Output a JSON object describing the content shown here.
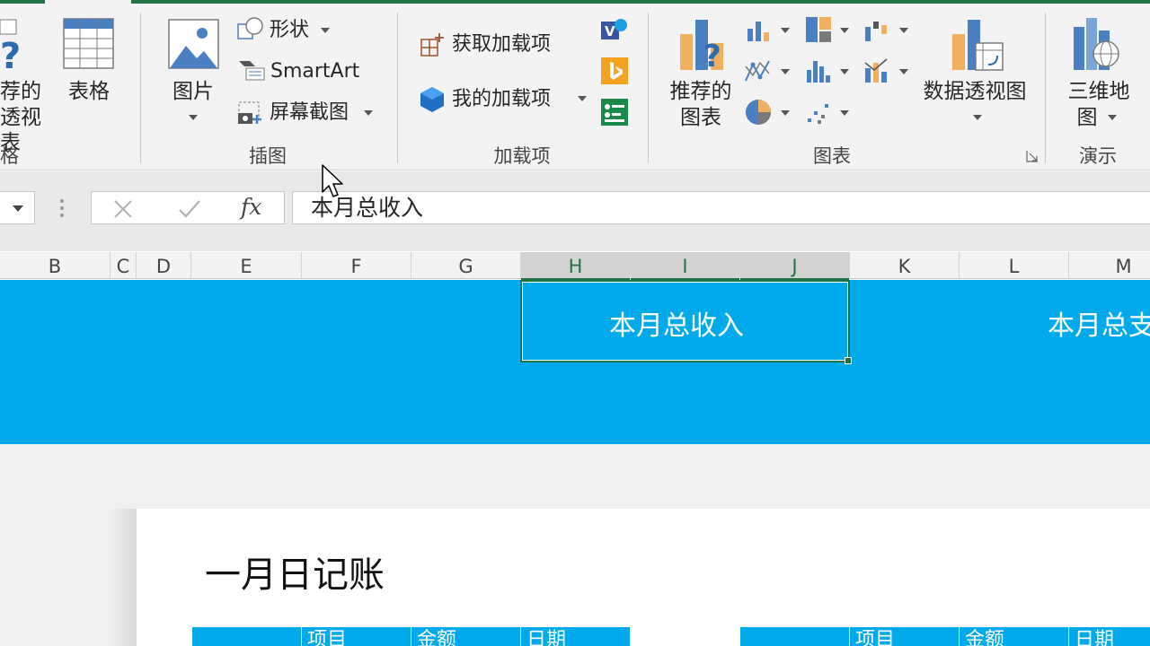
{
  "ribbon": {
    "clipped_left": {
      "label_line1": "荐的",
      "label_line2": "透视表",
      "group": "格"
    },
    "table": {
      "label": "表格"
    },
    "illustrations": {
      "picture": "图片",
      "shapes": "形状",
      "smartart": "SmartArt",
      "screenshot": "屏幕截图",
      "group": "插图"
    },
    "addins": {
      "get": "获取加载项",
      "my": "我的加载项",
      "group": "加载项"
    },
    "charts": {
      "recommended_line1": "推荐的",
      "recommended_line2": "图表",
      "pivot_chart": "数据透视图",
      "group": "图表"
    },
    "tours": {
      "map_line1": "三维地",
      "map_line2": "图",
      "group": "演示"
    }
  },
  "formula_bar": {
    "fx": "fx",
    "content": "本月总收入"
  },
  "columns": [
    "B",
    "C",
    "D",
    "E",
    "F",
    "G",
    "H",
    "I",
    "J",
    "K",
    "L",
    "M"
  ],
  "sheet": {
    "banner_cell_1": "本月总收入",
    "banner_cell_2": "本月总支",
    "card_title": "一月日记账",
    "table1_headers": [
      "项目",
      "金额",
      "日期"
    ],
    "table2_headers": [
      "项目",
      "金额",
      "日期"
    ]
  },
  "colors": {
    "banner": "#00aaea",
    "accent_green": "#217346",
    "ribbon_bg": "#f3f3f3"
  }
}
